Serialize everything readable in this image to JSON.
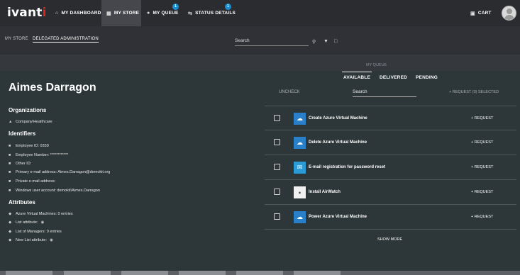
{
  "header": {
    "logo": "ivanti",
    "nav": [
      {
        "label": "MY DASHBOARD",
        "icon": "home-icon"
      },
      {
        "label": "MY STORE",
        "icon": "store-icon",
        "active": true
      },
      {
        "label": "MY QUEUE",
        "icon": "chat-icon",
        "badge": "1"
      },
      {
        "label": "STATUS DETAILS",
        "icon": "arrows-icon",
        "badge": "1"
      }
    ],
    "cart_label": "CART"
  },
  "subnav": {
    "links": [
      "MY STORE",
      "DELEGATED ADMINISTRATION"
    ],
    "search_placeholder": "Search"
  },
  "background": {
    "my_queue_label": "MY QUEUE"
  },
  "person": {
    "name": "Aimes Darragon",
    "organizations_title": "Organizations",
    "organization": "Company\\Healthcare",
    "identifiers_title": "Identifiers",
    "identifiers": [
      "Employee ID: 0339",
      "Employee Number: ************",
      "Other ID:",
      "Primary e-mail address: Aimes.Darragon@demokit.org",
      "Private e-mail address:",
      "Windows user account: demokit\\Aimes.Darragon"
    ],
    "attributes_title": "Attributes",
    "attributes": [
      "Azure Virtual Machines: 0 entries",
      "List attribute:",
      "List of Managers: 0 entries",
      "New List attribute:"
    ]
  },
  "requests": {
    "tabs": [
      "AVAILABLE",
      "DELIVERED",
      "PENDING"
    ],
    "uncheck_label": "UNCHECK",
    "search_placeholder": "Search",
    "selected_label": "REQUEST (0) SELECTED",
    "items": [
      {
        "name": "Create Azure Virtual Machine",
        "icon": "azure-cloud-icon",
        "request_label": "REQUEST"
      },
      {
        "name": "Delete Azure Virtual Machine",
        "icon": "azure-cloud-icon",
        "request_label": "REQUEST"
      },
      {
        "name": "E-mail registration for password reset",
        "icon": "envelope-icon",
        "request_label": "REQUEST"
      },
      {
        "name": "Install AirWatch",
        "icon": "airwatch-icon",
        "request_label": "REQUEST"
      },
      {
        "name": "Power Azure Virtual Machine",
        "icon": "azure-cloud-icon",
        "request_label": "REQUEST"
      }
    ],
    "show_more_label": "SHOW MORE"
  }
}
